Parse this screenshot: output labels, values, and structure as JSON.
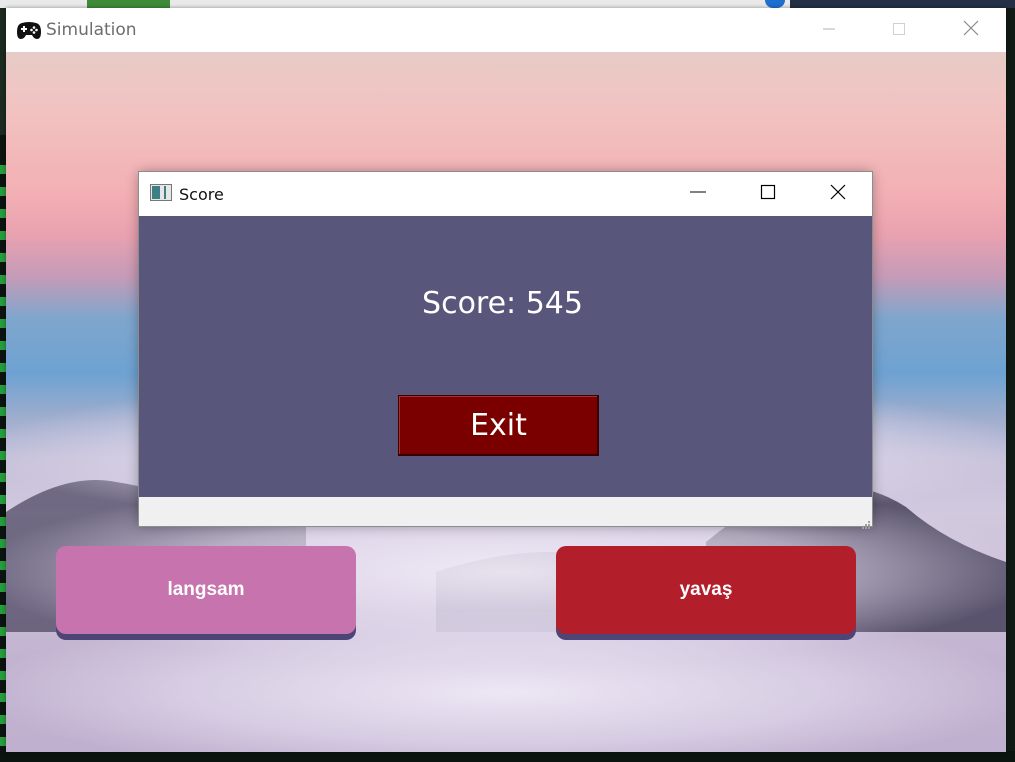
{
  "simulation_window": {
    "title": "Simulation",
    "icon": "gamepad-icon",
    "controls": {
      "minimize": "minimize-icon",
      "maximize": "maximize-icon",
      "close": "close-icon"
    }
  },
  "options": {
    "left_label": "langsam",
    "right_label": "yavaş",
    "left_color": "#c773ad",
    "right_color": "#b31e2b"
  },
  "score_dialog": {
    "title": "Score",
    "icon": "window-app-icon",
    "score_text": "Score: 545",
    "exit_label": "Exit",
    "exit_color": "#7a0000",
    "background_color": "#59567c"
  }
}
